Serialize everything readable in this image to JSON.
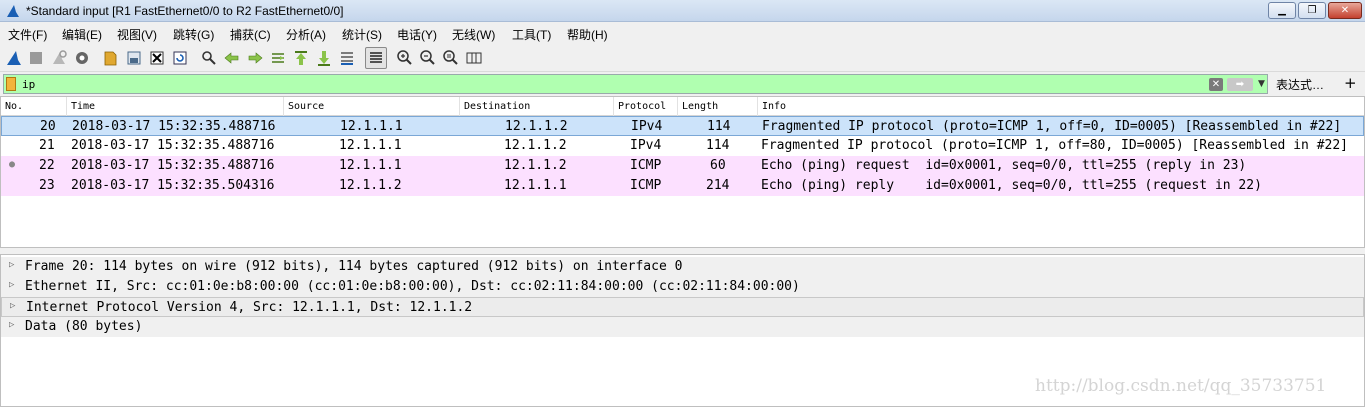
{
  "window": {
    "title": "*Standard input [R1 FastEthernet0/0 to R2 FastEthernet0/0]",
    "controls": {
      "minimize": "▁",
      "maximize": "❐",
      "close": "✕"
    }
  },
  "menu": [
    "文件(F)",
    "编辑(E)",
    "视图(V)",
    "跳转(G)",
    "捕获(C)",
    "分析(A)",
    "统计(S)",
    "电话(Y)",
    "无线(W)",
    "工具(T)",
    "帮助(H)"
  ],
  "toolbar": {
    "icons": [
      "shark-fin-start-icon",
      "stop-capture-icon",
      "restart-capture-icon",
      "capture-options-icon",
      "open-file-icon",
      "save-file-icon",
      "close-file-icon",
      "reload-file-icon",
      "find-packet-icon",
      "go-back-icon",
      "go-forward-icon",
      "go-to-packet-icon",
      "first-packet-icon",
      "last-packet-icon",
      "auto-scroll-icon",
      "colorize-icon",
      "zoom-in-icon",
      "zoom-out-icon",
      "normal-size-icon",
      "resize-columns-icon"
    ]
  },
  "filter": {
    "value": "ip",
    "expression_label": "表达式…",
    "plus_label": "+"
  },
  "packet_list": {
    "columns": [
      "No.",
      "Time",
      "Source",
      "Destination",
      "Protocol",
      "Length",
      "Info"
    ],
    "rows": [
      {
        "no": "20",
        "time": "2018-03-17 15:32:35.488716",
        "src": "12.1.1.1",
        "dst": "12.1.1.2",
        "proto": "IPv4",
        "len": "114",
        "info": "Fragmented IP protocol (proto=ICMP 1, off=0, ID=0005) [Reassembled in #22]"
      },
      {
        "no": "21",
        "time": "2018-03-17 15:32:35.488716",
        "src": "12.1.1.1",
        "dst": "12.1.1.2",
        "proto": "IPv4",
        "len": "114",
        "info": "Fragmented IP protocol (proto=ICMP 1, off=80, ID=0005) [Reassembled in #22]"
      },
      {
        "no": "22",
        "time": "2018-03-17 15:32:35.488716",
        "src": "12.1.1.1",
        "dst": "12.1.1.2",
        "proto": "ICMP",
        "len": "60",
        "info": "Echo (ping) request  id=0x0001, seq=0/0, ttl=255 (reply in 23)"
      },
      {
        "no": "23",
        "time": "2018-03-17 15:32:35.504316",
        "src": "12.1.1.2",
        "dst": "12.1.1.1",
        "proto": "ICMP",
        "len": "214",
        "info": "Echo (ping) reply    id=0x0001, seq=0/0, ttl=255 (request in 22)"
      }
    ]
  },
  "details": [
    "Frame 20: 114 bytes on wire (912 bits), 114 bytes captured (912 bits) on interface 0",
    "Ethernet II, Src: cc:01:0e:b8:00:00 (cc:01:0e:b8:00:00), Dst: cc:02:11:84:00:00 (cc:02:11:84:00:00)",
    "Internet Protocol Version 4, Src: 12.1.1.1, Dst: 12.1.1.2",
    "Data (80 bytes)"
  ],
  "watermark": "http://blog.csdn.net/qq_35733751",
  "colors": {
    "filter_ok": "#b0ffb0",
    "icmp_row": "#fce0ff",
    "selected_row": "#cce3fa"
  }
}
